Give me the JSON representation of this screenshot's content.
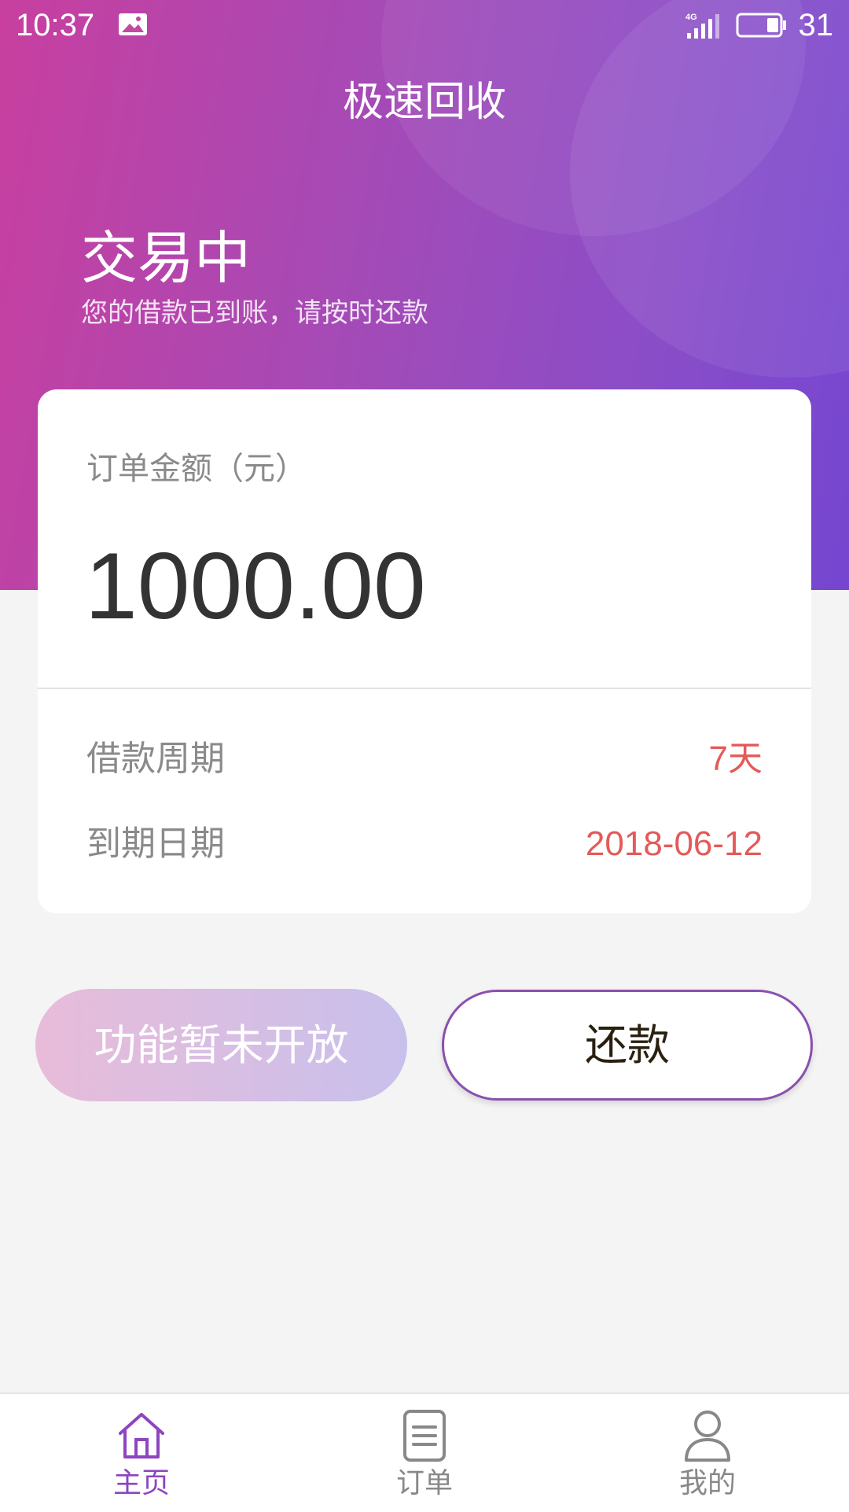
{
  "status_bar": {
    "time": "10:37",
    "battery": "31",
    "icons": [
      "image-notification-icon",
      "signal-4g-icon",
      "battery-icon"
    ]
  },
  "header": {
    "title": "极速回收"
  },
  "status": {
    "heading": "交易中",
    "subtitle": "您的借款已到账，请按时还款"
  },
  "order_card": {
    "amount_label": "订单金额（元）",
    "amount": "1000.00",
    "rows": [
      {
        "label": "借款周期",
        "value": "7天"
      },
      {
        "label": "到期日期",
        "value": "2018-06-12"
      }
    ]
  },
  "actions": {
    "disabled_label": "功能暂未开放",
    "repay_label": "还款"
  },
  "bottom_nav": {
    "items": [
      {
        "label": "主页",
        "icon": "home-icon",
        "active": true
      },
      {
        "label": "订单",
        "icon": "order-list-icon",
        "active": false
      },
      {
        "label": "我的",
        "icon": "user-icon",
        "active": false
      }
    ]
  },
  "colors": {
    "accent": "#8d45c0",
    "gradient_start": "#c83f9f",
    "gradient_end": "#7546d0",
    "highlight_value": "#e45a5a"
  }
}
